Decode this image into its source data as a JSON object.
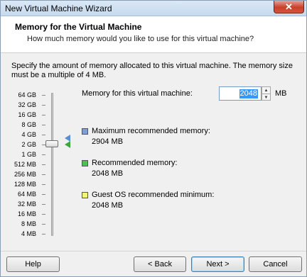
{
  "window": {
    "title": "New Virtual Machine Wizard"
  },
  "header": {
    "title": "Memory for the Virtual Machine",
    "subtitle": "How much memory would you like to use for this virtual machine?"
  },
  "description": "Specify the amount of memory allocated to this virtual machine. The memory size must be a multiple of 4 MB.",
  "scale": [
    "64 GB",
    "32 GB",
    "16 GB",
    "8 GB",
    "4 GB",
    "2 GB",
    "1 GB",
    "512 MB",
    "256 MB",
    "128 MB",
    "64 MB",
    "32 MB",
    "16 MB",
    "8 MB",
    "4 MB"
  ],
  "memory": {
    "label": "Memory for this virtual machine:",
    "value": "2048",
    "unit": "MB",
    "slider_selected": "2 GB"
  },
  "legend": [
    {
      "label": "Maximum recommended memory:",
      "value": "2904 MB",
      "color": "#7f9fcf"
    },
    {
      "label": "Recommended memory:",
      "value": "2048 MB",
      "color": "#4fc04f"
    },
    {
      "label": "Guest OS recommended minimum:",
      "value": "2048 MB",
      "color": "#f4f47a"
    }
  ],
  "buttons": {
    "help": "Help",
    "back": "< Back",
    "next": "Next >",
    "cancel": "Cancel"
  },
  "icons": {
    "close": "close-icon",
    "spin_up": "chevron-up-icon",
    "spin_down": "chevron-down-icon"
  }
}
